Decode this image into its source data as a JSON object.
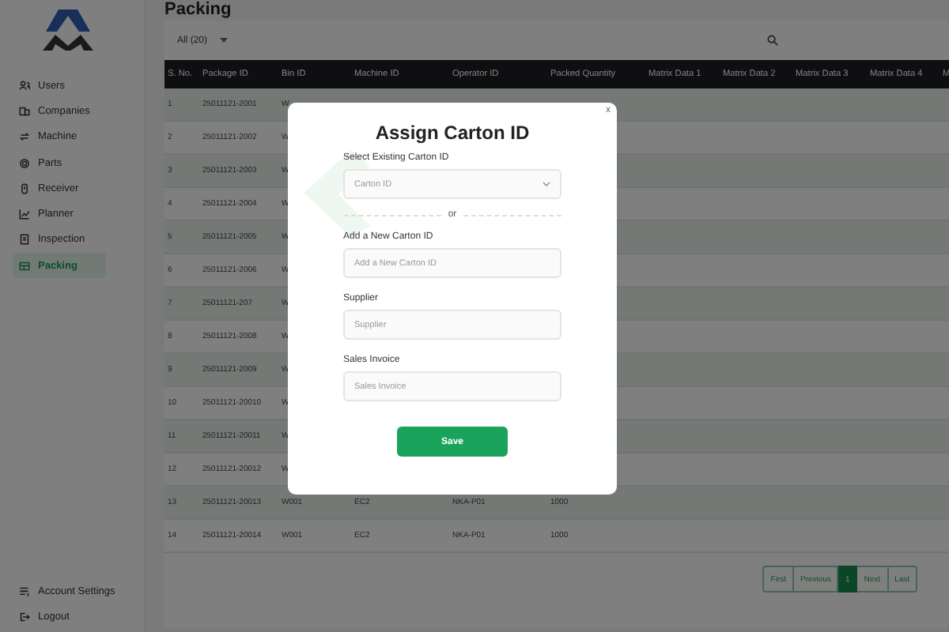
{
  "page": {
    "title": "Packing"
  },
  "sidebar": {
    "items": [
      {
        "label": "Users",
        "selected": false
      },
      {
        "label": "Companies",
        "selected": false
      },
      {
        "label": "Machine",
        "selected": false
      },
      {
        "label": "Parts",
        "selected": false
      },
      {
        "label": "Receiver",
        "selected": false
      },
      {
        "label": "Planner",
        "selected": false
      },
      {
        "label": "Inspection",
        "selected": false
      },
      {
        "label": "Packing",
        "selected": true
      }
    ],
    "footer_items": [
      {
        "label": "Account Settings"
      },
      {
        "label": "Logout"
      }
    ]
  },
  "filter": {
    "value": "All (20)"
  },
  "table": {
    "columns": [
      "S. No.",
      "Package ID",
      "Bin ID",
      "Machine ID",
      "Operator ID",
      "Packed Quantity",
      "Matrix Data 1",
      "Matrix Data 2",
      "Matrix Data 3",
      "Matrix Data 4",
      "M"
    ],
    "rows": [
      [
        "1",
        "25011121-2001",
        "W"
      ],
      [
        "2",
        "25011121-2002",
        "W"
      ],
      [
        "3",
        "25011121-2003",
        "W"
      ],
      [
        "4",
        "25011121-2004",
        "W"
      ],
      [
        "5",
        "25011121-2005",
        "W"
      ],
      [
        "6",
        "25011121-2006",
        "W"
      ],
      [
        "7",
        "25011121-207",
        "W"
      ],
      [
        "8",
        "25011121-2008",
        "W"
      ],
      [
        "9",
        "25011121-2009",
        "W"
      ],
      [
        "10",
        "25011121-20010",
        "W"
      ],
      [
        "11",
        "25011121-20011",
        "W"
      ],
      [
        "12",
        "25011121-20012",
        "W"
      ],
      [
        "13",
        "25011121-20013",
        "W001",
        "EC2",
        "NKA-P01",
        "1000"
      ],
      [
        "14",
        "25011121-20014",
        "W001",
        "EC2",
        "NKA-P01",
        "1000"
      ]
    ]
  },
  "pagination": {
    "pages": [
      {
        "label": "First",
        "selected": false
      },
      {
        "label": "Previous",
        "selected": false
      },
      {
        "label": "1",
        "selected": true
      },
      {
        "label": "Next",
        "selected": false
      },
      {
        "label": "Last",
        "selected": false
      }
    ]
  },
  "modal": {
    "title": "Assign Carton ID",
    "close": "x",
    "fields": [
      {
        "kind": "select",
        "label": "Select Existing Carton ID",
        "placeholder": "Carton ID"
      },
      {
        "kind": "divider",
        "label": "or"
      },
      {
        "kind": "input",
        "label": "Add a New Carton ID",
        "placeholder": "Add a New Carton ID"
      },
      {
        "kind": "input",
        "label": "Supplier",
        "placeholder": "Supplier"
      },
      {
        "kind": "input",
        "label": "Sales Invoice",
        "placeholder": "Sales Invoice"
      }
    ],
    "submit": "Save"
  }
}
